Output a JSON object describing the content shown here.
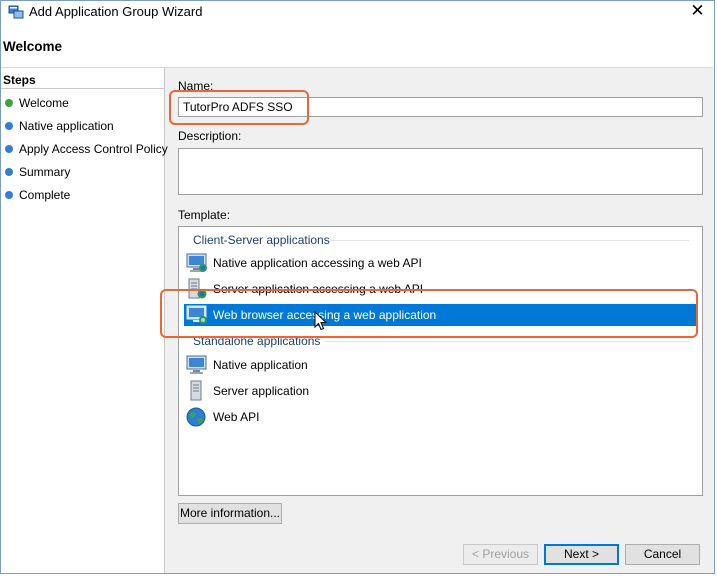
{
  "window": {
    "title": "Add Application Group Wizard",
    "close_glyph": "✕"
  },
  "header": {
    "title": "Welcome"
  },
  "steps": {
    "title": "Steps",
    "items": [
      {
        "label": "Welcome",
        "state": "current"
      },
      {
        "label": "Native application",
        "state": "pending"
      },
      {
        "label": "Apply Access Control Policy",
        "state": "pending"
      },
      {
        "label": "Summary",
        "state": "pending"
      },
      {
        "label": "Complete",
        "state": "pending"
      }
    ]
  },
  "form": {
    "name_label": "Name:",
    "name_value": "TutorPro ADFS SSO",
    "description_label": "Description:",
    "description_value": "",
    "template_label": "Template:"
  },
  "templates": {
    "groups": [
      {
        "title": "Client-Server applications",
        "items": [
          {
            "label": "Native application accessing a web API",
            "icon": "native-app-icon"
          },
          {
            "label": "Server application accessing a web API",
            "icon": "server-app-icon"
          },
          {
            "label": "Web browser accessing a web application",
            "icon": "web-browser-app-icon",
            "selected": true
          }
        ]
      },
      {
        "title": "Standalone applications",
        "items": [
          {
            "label": "Native application",
            "icon": "native-app-icon"
          },
          {
            "label": "Server application",
            "icon": "server-app-icon"
          },
          {
            "label": "Web API",
            "icon": "globe-icon"
          }
        ]
      }
    ]
  },
  "buttons": {
    "more_info": "More information...",
    "previous": "< Previous",
    "next": "Next >",
    "cancel": "Cancel"
  },
  "colors": {
    "accent": "#0078d7",
    "highlight_outline": "#e8673a",
    "step_current": "#3aa63a",
    "step_pending": "#2f7fd6",
    "group_title": "#1f3e78"
  }
}
